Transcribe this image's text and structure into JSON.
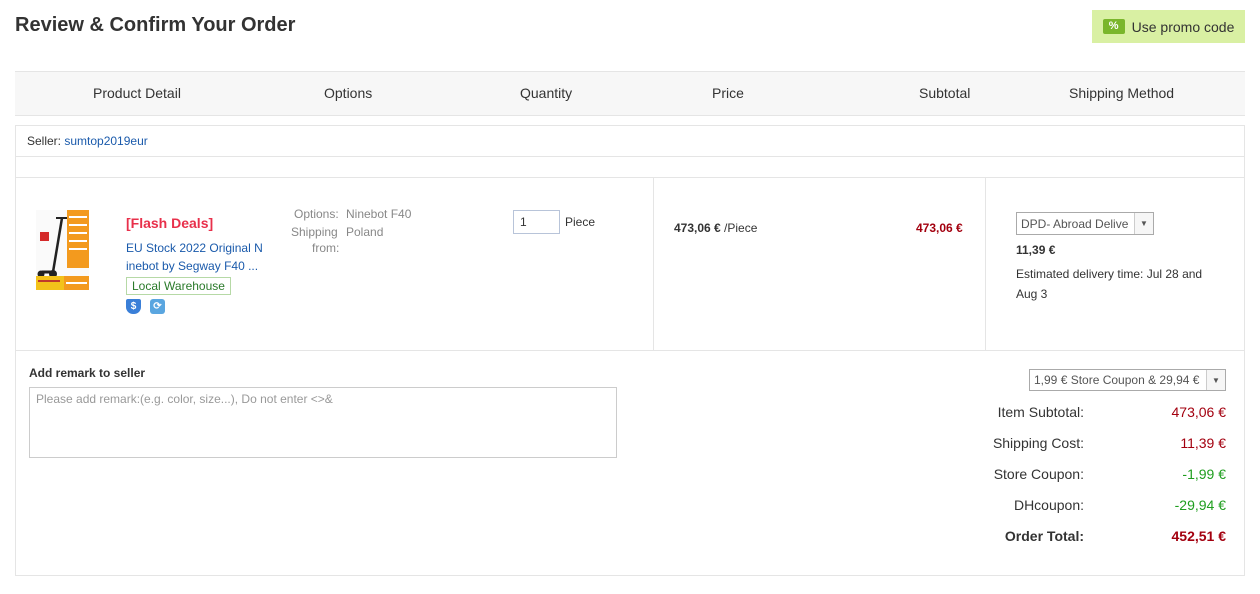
{
  "page": {
    "title": "Review & Confirm Your Order",
    "promo_label": "Use promo code",
    "promo_icon": "percent-tag-icon"
  },
  "table_headers": [
    "Product Detail",
    "Options",
    "Quantity",
    "Price",
    "Subtotal",
    "Shipping Method"
  ],
  "seller": {
    "label": "Seller:",
    "name": "sumtop2019eur"
  },
  "product": {
    "flash": "[Flash Deals]",
    "name_line1": "EU Stock 2022 Original N",
    "name_line2": "inebot by Segway F40 ...",
    "warehouse": "Local Warehouse",
    "badge_icons": [
      "dollar-shield-icon",
      "shipping-protect-icon"
    ],
    "options_label": "Options:",
    "options_value": "Ninebot F40",
    "ship_from_label_1": "Shipping",
    "ship_from_label_2": "from:",
    "ship_from_value": "Poland",
    "quantity": "1",
    "quantity_unit": "Piece",
    "price": "473,06 €",
    "price_unit": " /Piece",
    "subtotal": "473,06 €",
    "shipping_method": "DPD- Abroad Delive",
    "shipping_cost": "11,39 €",
    "delivery_estimate": "Estimated delivery time: Jul 28 and Aug 3"
  },
  "remark": {
    "label": "Add remark to seller",
    "placeholder": "Please add remark:(e.g. color, size...), Do not enter <>&"
  },
  "coupon_select": "1,99 € Store Coupon & 29,94 €",
  "summary": {
    "item_subtotal_label": "Item Subtotal:",
    "item_subtotal": "473,06 €",
    "shipping_cost_label": "Shipping Cost:",
    "shipping_cost": "11,39 €",
    "store_coupon_label": "Store Coupon:",
    "store_coupon": "-1,99 €",
    "dhcoupon_label": "DHcoupon:",
    "dhcoupon": "-29,94 €",
    "order_total_label": "Order Total:",
    "order_total": "452,51 €"
  },
  "colors": {
    "promo_bg": "#d9f0a3",
    "flash_red": "#e8304b",
    "link_blue": "#1a5aab",
    "total_red": "#a3000f",
    "discount_green": "#1e9e1e"
  }
}
